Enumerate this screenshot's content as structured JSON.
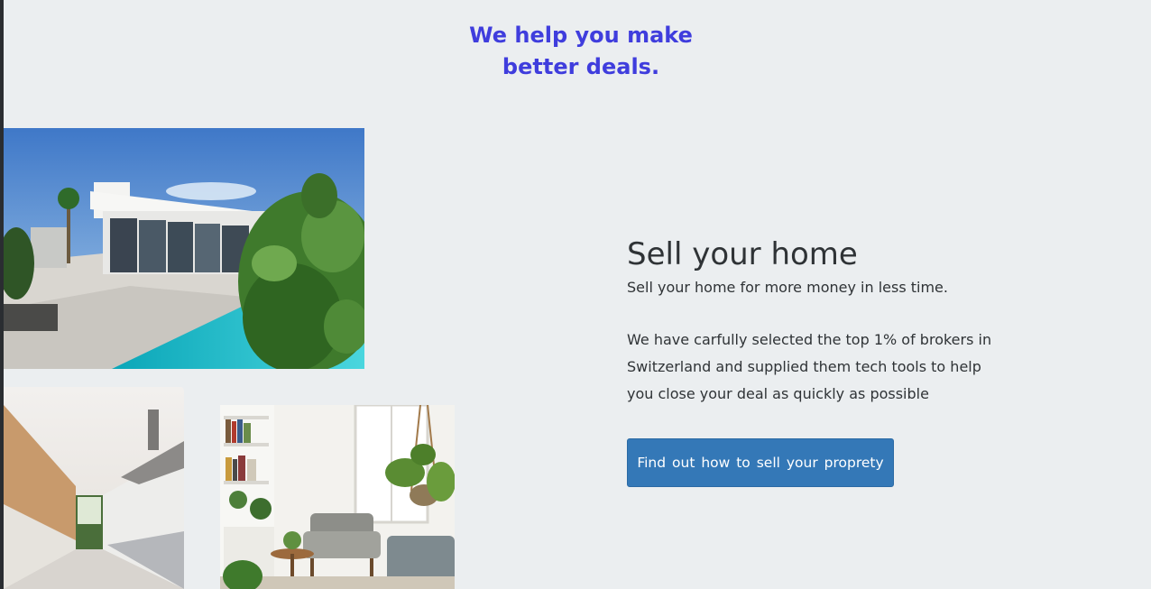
{
  "hero": {
    "tagline": "We help you make better deals."
  },
  "images": {
    "villa": "modern-villa-with-pool",
    "kitchen": "bright-galley-kitchen",
    "living_room": "living-room-with-plants"
  },
  "sell": {
    "title": "Sell your home",
    "subtitle": "Sell your home for more money in less time.",
    "description": "We have carfully selected the top 1% of brokers in Switzerland and supplied them tech tools to help you close your deal as quickly as possible",
    "button_label": "Find out how to sell your proprety"
  },
  "colors": {
    "background": "#ebeef0",
    "tagline": "#3f3ddd",
    "button": "#3478b7",
    "text": "#2f3336"
  }
}
